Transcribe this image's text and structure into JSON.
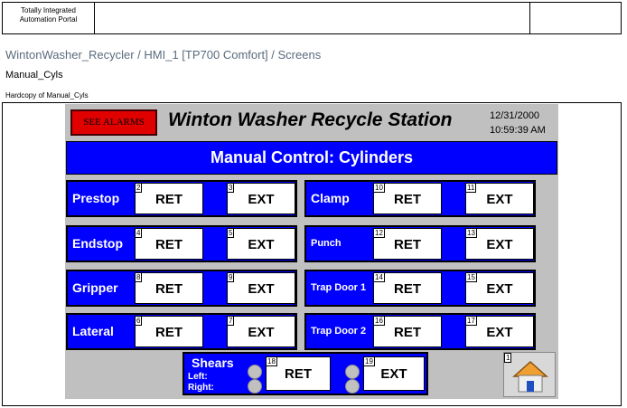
{
  "header": {
    "tia_label": "Totally Integrated Automation Portal"
  },
  "breadcrumb": "WintonWasher_Recycler / HMI_1 [TP700 Comfort] / Screens",
  "screen_name": "Manual_Cyls",
  "hardcopy_label": "Hardcopy of Manual_Cyls",
  "hmi": {
    "alarm_button": "SEE ALARMS",
    "title": "Winton Washer Recycle Station",
    "date": "12/31/2000",
    "time": "10:59:39 AM",
    "banner": "Manual Control: Cylinders",
    "rows": [
      {
        "label": "Prestop",
        "ret_num": "2",
        "ret": "RET",
        "ext_num": "3",
        "ext": "EXT"
      },
      {
        "label": "Endstop",
        "ret_num": "4",
        "ret": "RET",
        "ext_num": "5",
        "ext": "EXT"
      },
      {
        "label": "Gripper",
        "ret_num": "8",
        "ret": "RET",
        "ext_num": "9",
        "ext": "EXT"
      },
      {
        "label": "Lateral",
        "ret_num": "6",
        "ret": "RET",
        "ext_num": "7",
        "ext": "EXT"
      },
      {
        "label": "Clamp",
        "ret_num": "10",
        "ret": "RET",
        "ext_num": "11",
        "ext": "EXT"
      },
      {
        "label": "Punch",
        "ret_num": "12",
        "ret": "RET",
        "ext_num": "13",
        "ext": "EXT"
      },
      {
        "label": "Trap Door 1",
        "ret_num": "14",
        "ret": "RET",
        "ext_num": "15",
        "ext": "EXT"
      },
      {
        "label": "Trap Door 2",
        "ret_num": "16",
        "ret": "RET",
        "ext_num": "17",
        "ext": "EXT"
      }
    ],
    "shears": {
      "title": "Shears",
      "left": "Left:",
      "right": "Right:",
      "ret_num": "18",
      "ret": "RET",
      "ext_num": "19",
      "ext": "EXT"
    },
    "home_num": "1",
    "home_icon": "home-icon",
    "colors": {
      "blue": "#0000ff",
      "alarm": "#e00000",
      "panel": "#c0c0c0"
    }
  }
}
